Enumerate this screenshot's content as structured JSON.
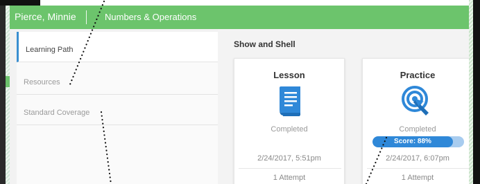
{
  "header": {
    "student_name": "Pierce, Minnie",
    "subject": "Numbers & Operations"
  },
  "sidebar": {
    "items": [
      {
        "label": "Learning Path",
        "active": true
      },
      {
        "label": "Resources",
        "active": false
      },
      {
        "label": "Standard Coverage",
        "active": false
      }
    ]
  },
  "main": {
    "section_title": "Show and Shell",
    "cards": [
      {
        "title": "Lesson",
        "icon": "book-icon",
        "status": "Completed",
        "date": "2/24/2017, 5:51pm",
        "attempts": "1 Attempt"
      },
      {
        "title": "Practice",
        "icon": "target-icon",
        "status": "Completed",
        "score_label": "Score: 88%",
        "score_fraction": 0.88,
        "date": "2/24/2017, 6:07pm",
        "attempts": "1 Attempt"
      }
    ]
  },
  "colors": {
    "header_green": "#6cc46c",
    "accent_blue": "#2f88d8",
    "score_track": "#a8ccef",
    "active_border": "#3a8fd0"
  }
}
